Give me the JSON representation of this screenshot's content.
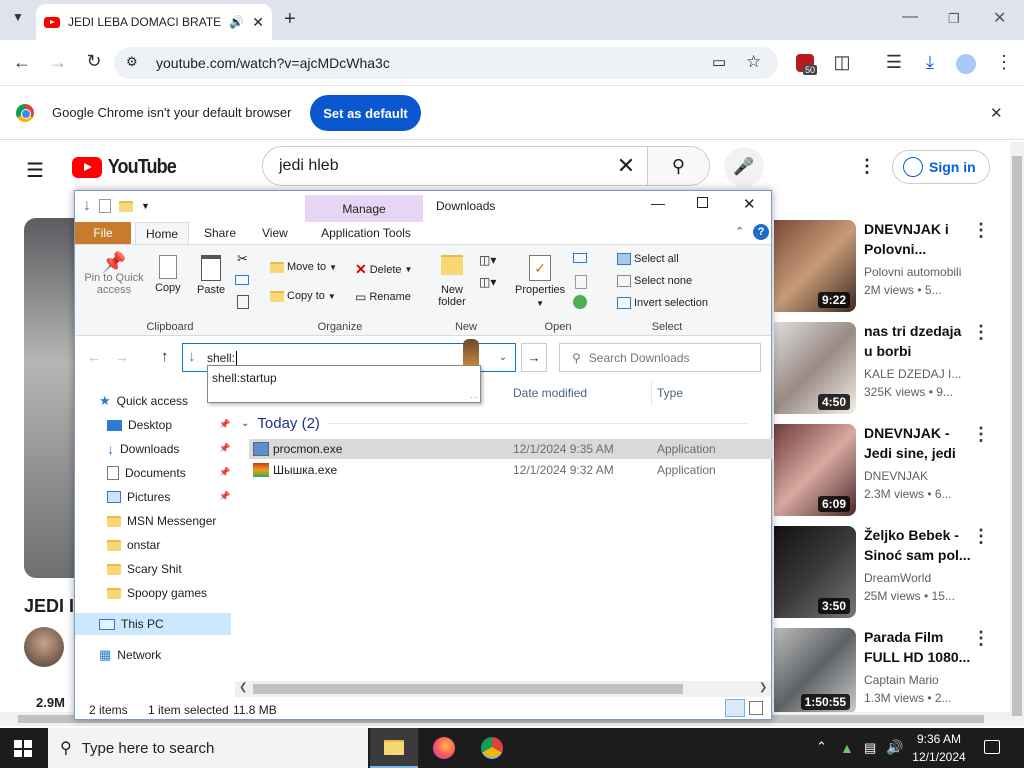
{
  "chrome": {
    "tab_title": "JEDI LEBA DOMACI BRATE",
    "url": "youtube.com/watch?v=ajcMDcWha3c",
    "infobar_text": "Google Chrome isn't your default browser",
    "set_default_label": "Set as default",
    "extension_badge": "50"
  },
  "youtube": {
    "logo_text": "YouTube",
    "search_value": "jedi hleb",
    "sign_in_label": "Sign in",
    "video_title_partial": "JEDI I",
    "views_partial": "2.9M",
    "recommendations": [
      {
        "title": "DNEVNJAK i Polovni...",
        "channel": "Polovni automobili",
        "meta": "2M views • 5...",
        "duration": "9:22"
      },
      {
        "title": "nas tri dzedaja u borbi",
        "channel": "KALE DZEDAJ I...",
        "meta": "325K views • 9...",
        "duration": "4:50"
      },
      {
        "title": "DNEVNJAK - Jedi sine, jedi",
        "channel": "DNEVNJAK",
        "meta": "2.3M views • 6...",
        "duration": "6:09"
      },
      {
        "title": "Željko Bebek - Sinoć sam pol...",
        "channel": "DreamWorld",
        "meta": "25M views • 15...",
        "duration": "3:50"
      },
      {
        "title": "Parada Film FULL HD 1080...",
        "channel": "Captain Mario",
        "meta": "1.3M views • 2...",
        "duration": "1:50:55"
      }
    ]
  },
  "explorer": {
    "manage_label": "Manage",
    "window_title": "Downloads",
    "tabs": {
      "file": "File",
      "home": "Home",
      "share": "Share",
      "view": "View",
      "app_tools": "Application Tools"
    },
    "ribbon": {
      "pin": "Pin to Quick access",
      "copy": "Copy",
      "paste": "Paste",
      "move_to": "Move to",
      "copy_to": "Copy to",
      "delete": "Delete",
      "rename": "Rename",
      "new_folder": "New folder",
      "properties": "Properties",
      "select_all": "Select all",
      "select_none": "Select none",
      "invert_selection": "Invert selection",
      "groups": {
        "clipboard": "Clipboard",
        "organize": "Organize",
        "new": "New",
        "open": "Open",
        "select": "Select"
      }
    },
    "address_value": "shell:",
    "autocomplete": "shell:startup",
    "search_placeholder": "Search Downloads",
    "columns": {
      "date": "Date modified",
      "type": "Type"
    },
    "group_header": "Today (2)",
    "files": [
      {
        "name": "procmon.exe",
        "date": "12/1/2024 9:35 AM",
        "type": "Application"
      },
      {
        "name": "Шышка.exe",
        "date": "12/1/2024 9:32 AM",
        "type": "Application"
      }
    ],
    "nav": {
      "quick_access": "Quick access",
      "items": [
        "Desktop",
        "Downloads",
        "Documents",
        "Pictures",
        "MSN Messenger",
        "onstar",
        "Scary Shit",
        "Spoopy games"
      ],
      "this_pc": "This PC",
      "network": "Network"
    },
    "status": {
      "items": "2 items",
      "selected": "1 item selected",
      "size": "11.8 MB"
    }
  },
  "taskbar": {
    "search_placeholder": "Type here to search",
    "time": "9:36 AM",
    "date": "12/1/2024"
  }
}
